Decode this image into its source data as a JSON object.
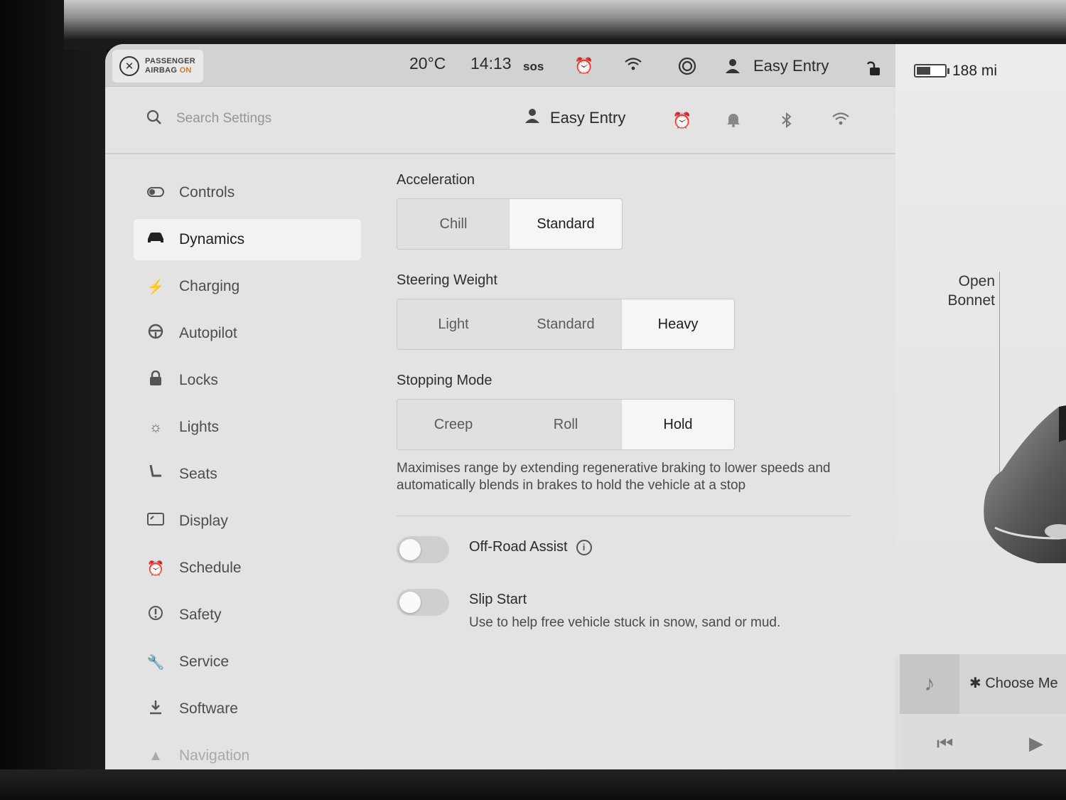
{
  "status_bar": {
    "airbag_line1": "PASSENGER",
    "airbag_line2": "AIRBAG",
    "airbag_state": "ON",
    "temperature": "20°C",
    "time": "14:13",
    "sos_label": "sos",
    "profile_name": "Easy Entry",
    "range": "188 mi",
    "battery_level": 0.5
  },
  "header": {
    "search_placeholder": "Search Settings",
    "profile_name": "Easy Entry"
  },
  "sidebar": {
    "items": [
      {
        "label": "Controls",
        "icon": "toggle-icon"
      },
      {
        "label": "Dynamics",
        "icon": "car-icon",
        "active": true
      },
      {
        "label": "Charging",
        "icon": "bolt-icon"
      },
      {
        "label": "Autopilot",
        "icon": "steering-wheel-icon"
      },
      {
        "label": "Locks",
        "icon": "lock-icon"
      },
      {
        "label": "Lights",
        "icon": "sun-icon"
      },
      {
        "label": "Seats",
        "icon": "seat-icon"
      },
      {
        "label": "Display",
        "icon": "display-icon"
      },
      {
        "label": "Schedule",
        "icon": "alarm-icon"
      },
      {
        "label": "Safety",
        "icon": "alert-circle-icon"
      },
      {
        "label": "Service",
        "icon": "wrench-icon"
      },
      {
        "label": "Software",
        "icon": "download-icon"
      },
      {
        "label": "Navigation",
        "icon": "navigation-icon"
      }
    ]
  },
  "dynamics": {
    "acceleration": {
      "title": "Acceleration",
      "options": [
        "Chill",
        "Standard"
      ],
      "selected": "Standard"
    },
    "steering_weight": {
      "title": "Steering Weight",
      "options": [
        "Light",
        "Standard",
        "Heavy"
      ],
      "selected": "Heavy"
    },
    "stopping_mode": {
      "title": "Stopping Mode",
      "options": [
        "Creep",
        "Roll",
        "Hold"
      ],
      "selected": "Hold",
      "description": "Maximises range by extending regenerative braking to lower speeds and automatically blends in brakes to hold the vehicle at a stop"
    },
    "off_road_assist": {
      "label": "Off-Road Assist",
      "enabled": false
    },
    "slip_start": {
      "label": "Slip Start",
      "description": "Use to help free vehicle stuck in snow, sand or mud.",
      "enabled": false
    }
  },
  "car_panel": {
    "open_bonnet_line1": "Open",
    "open_bonnet_line2": "Bonnet"
  },
  "media": {
    "choose_label": "Choose Me"
  },
  "colors": {
    "airbag_on": "#d07b2a",
    "screen_bg": "#e3e3e3",
    "selected_segment": "#f6f6f6"
  }
}
